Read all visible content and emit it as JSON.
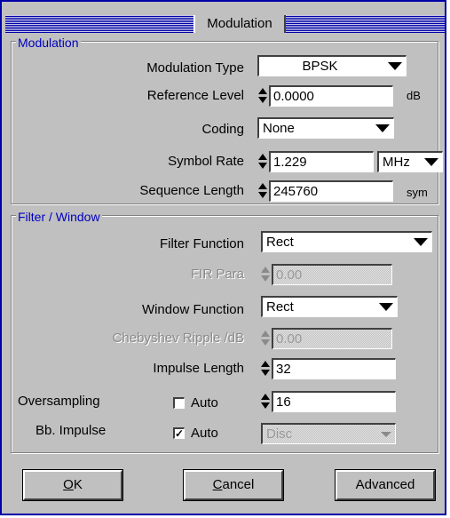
{
  "window": {
    "title": "Modulation"
  },
  "modulation_group": {
    "title": "Modulation",
    "modulation_type": {
      "label": "Modulation Type",
      "value": "BPSK"
    },
    "reference_level": {
      "label": "Reference Level",
      "value": "0.0000",
      "unit": "dB"
    },
    "coding": {
      "label": "Coding",
      "value": "None"
    },
    "symbol_rate": {
      "label": "Symbol  Rate",
      "value": "1.229",
      "unit": "MHz"
    },
    "sequence_length": {
      "label": "Sequence Length",
      "value": "245760",
      "unit": "sym"
    }
  },
  "filter_group": {
    "title": "Filter / Window",
    "filter_function": {
      "label": "Filter Function",
      "value": "Rect"
    },
    "fir_para": {
      "label": "FIR Para",
      "value": "0.00"
    },
    "window_function": {
      "label": "Window Function",
      "value": "Rect"
    },
    "chebyshev_ripple": {
      "label": "Chebyshev Ripple /dB",
      "value": "0.00"
    },
    "impulse_length": {
      "label": "Impulse Length",
      "value": "32"
    },
    "oversampling": {
      "label": "Oversampling",
      "auto_label": "Auto",
      "auto_checked": false,
      "value": "16"
    },
    "bb_impulse": {
      "label": "Bb. Impulse",
      "auto_label": "Auto",
      "auto_checked": true,
      "value": "Disc"
    }
  },
  "buttons": {
    "ok_u": "O",
    "ok_rest": "K",
    "cancel_u": "C",
    "cancel_rest": "ancel",
    "advanced": "Advanced"
  }
}
